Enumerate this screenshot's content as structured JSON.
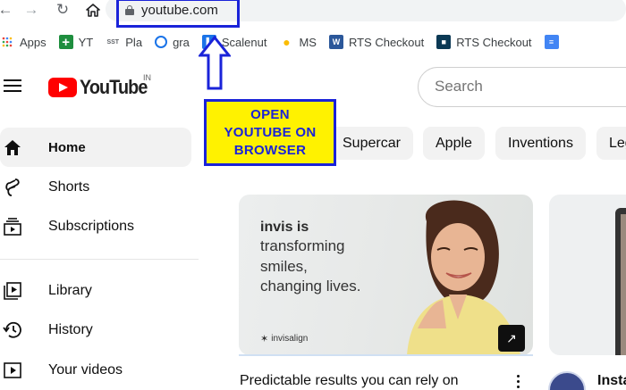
{
  "browser": {
    "url": "youtube.com",
    "back_icon": "arrow-left-icon",
    "forward_icon": "arrow-right-icon",
    "reload_icon": "reload-icon",
    "home_icon": "home-icon"
  },
  "bookmarks": [
    {
      "label": "Apps",
      "icon": "apps-grid-icon",
      "color": "#ea4335"
    },
    {
      "label": "YT",
      "icon": "plus-icon",
      "color": "#1e8e3e"
    },
    {
      "label": "Pla",
      "icon": "sst-icon",
      "color": "#9aa0a6"
    },
    {
      "label": "gra",
      "icon": "grammarly-icon",
      "color": "#15c39a"
    },
    {
      "label": "Scalenut",
      "icon": "scalenut-icon",
      "color": "#1a73e8"
    },
    {
      "label": "MS",
      "icon": "bulb-icon",
      "color": "#fbbc04"
    },
    {
      "label": "RTS Checkout",
      "icon": "word-icon",
      "color": "#2b579a"
    },
    {
      "label": "RTS Checkout",
      "icon": "chart-icon",
      "color": "#0b3954"
    }
  ],
  "youtube": {
    "logo_text": "YouTube",
    "country_code": "IN",
    "search_placeholder": "Search"
  },
  "sidebar": [
    {
      "label": "Home",
      "icon": "home-icon",
      "active": true
    },
    {
      "label": "Shorts",
      "icon": "shorts-icon",
      "active": false
    },
    {
      "label": "Subscriptions",
      "icon": "subscriptions-icon",
      "active": false
    },
    {
      "label": "Library",
      "icon": "library-icon",
      "active": false
    },
    {
      "label": "History",
      "icon": "history-icon",
      "active": false
    },
    {
      "label": "Your videos",
      "icon": "your-videos-icon",
      "active": false
    }
  ],
  "chips": [
    "Supercar",
    "Apple",
    "Inventions",
    "Leg"
  ],
  "callout": {
    "lines": [
      "OPEN",
      "YOUTUBE ON",
      "BROWSER"
    ],
    "text_color": "#1a23d9",
    "bg_color": "#fff200"
  },
  "ad": {
    "brand": "invis is",
    "lines": [
      "transforming",
      "smiles,",
      "changing lives."
    ],
    "logo": "invisalign",
    "title": "Predictable results you can rely on"
  },
  "second_card": {
    "channel": "Insta"
  }
}
